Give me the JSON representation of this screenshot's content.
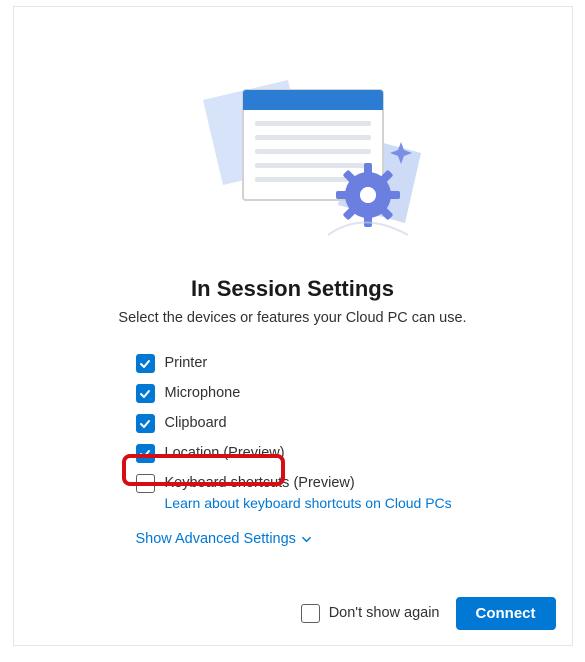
{
  "title": "In Session Settings",
  "subtitle": "Select the devices or features your Cloud PC can use.",
  "options": [
    {
      "id": "printer",
      "label": "Printer",
      "checked": true,
      "link": null
    },
    {
      "id": "microphone",
      "label": "Microphone",
      "checked": true,
      "link": null
    },
    {
      "id": "clipboard",
      "label": "Clipboard",
      "checked": true,
      "link": null
    },
    {
      "id": "location",
      "label": "Location (Preview)",
      "checked": true,
      "link": null,
      "highlighted": true
    },
    {
      "id": "keyboard",
      "label": "Keyboard shortcuts (Preview)",
      "checked": false,
      "link": "Learn about keyboard shortcuts on Cloud PCs"
    }
  ],
  "advanced_label": "Show Advanced Settings",
  "footer": {
    "dont_show_label": "Don't show again",
    "dont_show_checked": false,
    "connect_label": "Connect"
  },
  "colors": {
    "accent": "#0078d4",
    "highlight": "#d40e14"
  }
}
